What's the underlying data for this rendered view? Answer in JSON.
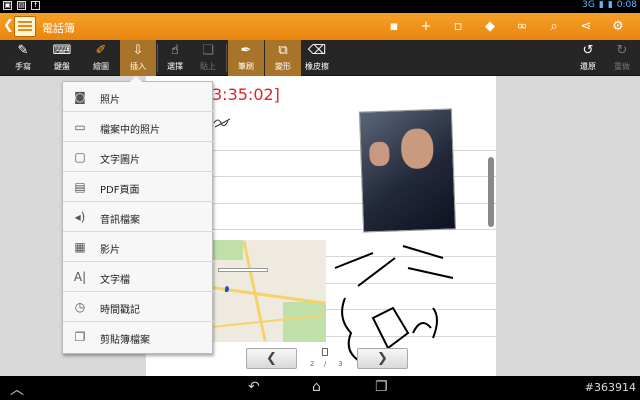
{
  "status_bar": {
    "network": "3G",
    "time": "0:08"
  },
  "title_bar": {
    "title": "電話簿"
  },
  "toolbar": {
    "tools": [
      {
        "label": "手寫"
      },
      {
        "label": "鍵盤"
      },
      {
        "label": "繪圖"
      },
      {
        "label": "插入"
      },
      {
        "label": "選擇"
      },
      {
        "label": "貼上"
      },
      {
        "label": "筆刷"
      },
      {
        "label": "變形"
      },
      {
        "label": "橡皮擦"
      }
    ],
    "undo_label": "還原",
    "redo_label": "重做"
  },
  "insert_menu": {
    "items": [
      {
        "label": "照片",
        "icon": "camera-icon"
      },
      {
        "label": "檔案中的照片",
        "icon": "image-icon"
      },
      {
        "label": "文字圖片",
        "icon": "text-image-icon"
      },
      {
        "label": "PDF頁面",
        "icon": "pdf-icon"
      },
      {
        "label": "音訊檔案",
        "icon": "audio-icon"
      },
      {
        "label": "影片",
        "icon": "video-icon"
      },
      {
        "label": "文字檔",
        "icon": "text-file-icon"
      },
      {
        "label": "時間戳記",
        "icon": "clock-icon"
      },
      {
        "label": "剪貼簿檔案",
        "icon": "clipboard-icon"
      }
    ]
  },
  "note": {
    "timestamp_text": "3:35:02]"
  },
  "pager": {
    "current": "2",
    "separator": "/",
    "total": "3"
  },
  "watermark": "#363914",
  "colors": {
    "accent": "#f29a21",
    "active_tool": "#a8742a",
    "timestamp": "#e0222a"
  }
}
